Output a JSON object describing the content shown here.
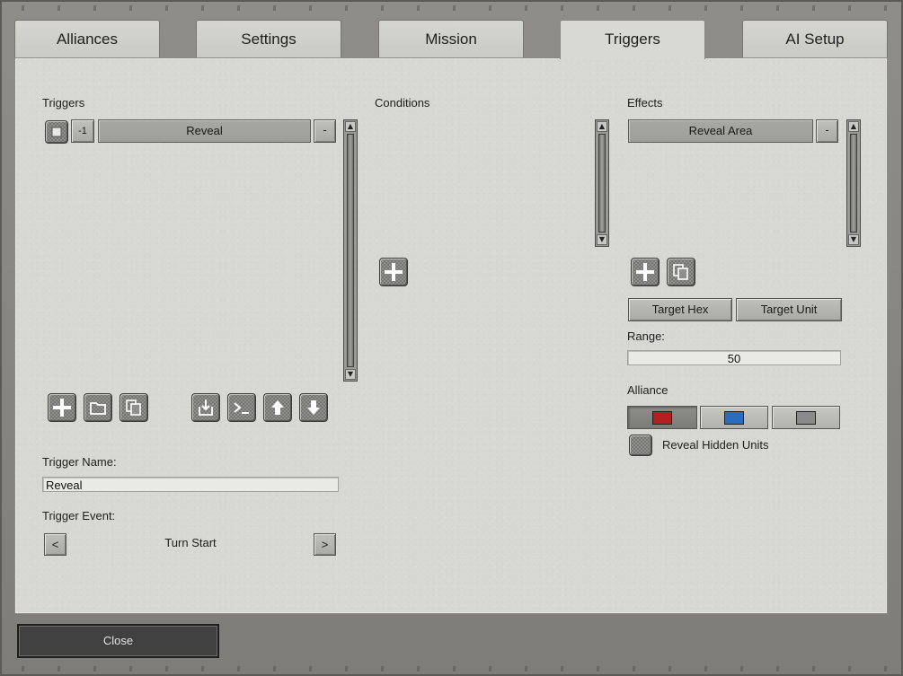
{
  "tabs": [
    {
      "label": "Alliances"
    },
    {
      "label": "Settings"
    },
    {
      "label": "Mission"
    },
    {
      "label": "Triggers",
      "active": true
    },
    {
      "label": "AI Setup"
    }
  ],
  "triggers": {
    "heading": "Triggers",
    "list": [
      {
        "index": "-1",
        "name": "Reveal",
        "remove_label": "-"
      }
    ],
    "toolbar_icons": [
      "add-icon",
      "folder-icon",
      "copy-icon",
      "import-icon",
      "console-icon",
      "move-up-icon",
      "move-down-icon"
    ],
    "name_label": "Trigger Name:",
    "name_value": "Reveal",
    "event_label": "Trigger Event:",
    "event_value": "Turn Start",
    "event_prev": "<",
    "event_next": ">"
  },
  "conditions": {
    "heading": "Conditions",
    "add_icon": "add-icon"
  },
  "effects": {
    "heading": "Effects",
    "list": [
      {
        "name": "Reveal Area",
        "remove_label": "-"
      }
    ],
    "target_hex_label": "Target Hex",
    "target_unit_label": "Target Unit",
    "range_label": "Range:",
    "range_value": "50",
    "alliance_label": "Alliance",
    "alliance_colors": [
      {
        "color": "#b22020",
        "selected": true
      },
      {
        "color": "#2a6cc0",
        "selected": false
      },
      {
        "color": "#8a8a8a",
        "selected": false
      }
    ],
    "reveal_hidden_label": "Reveal Hidden Units"
  },
  "footer": {
    "close_label": "Close"
  }
}
